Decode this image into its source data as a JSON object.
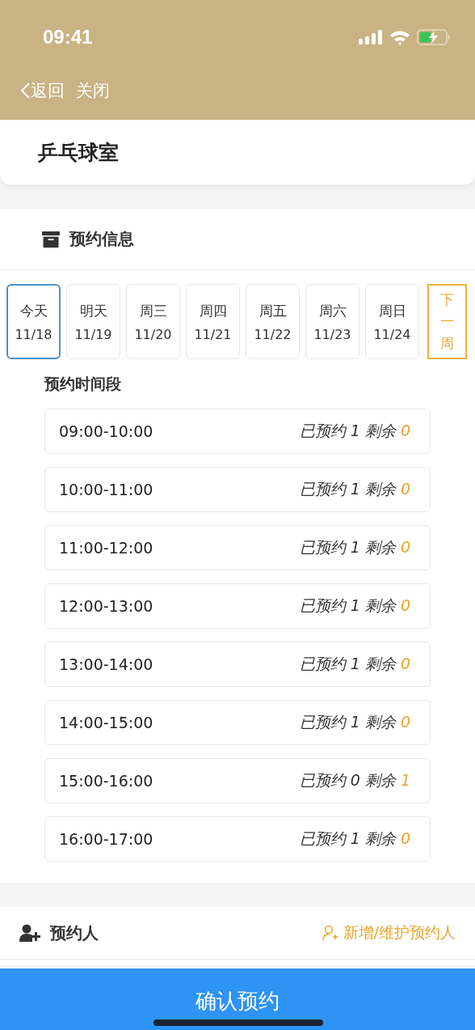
{
  "status_bar": {
    "time": "09:41"
  },
  "nav": {
    "back": "返回",
    "close": "关闭"
  },
  "venue": {
    "title": "乒乓球室"
  },
  "booking": {
    "title": "预约信息",
    "days": [
      {
        "label": "今天",
        "date": "11/18",
        "selected": true
      },
      {
        "label": "明天",
        "date": "11/19",
        "selected": false
      },
      {
        "label": "周三",
        "date": "11/20",
        "selected": false
      },
      {
        "label": "周四",
        "date": "11/21",
        "selected": false
      },
      {
        "label": "周五",
        "date": "11/22",
        "selected": false
      },
      {
        "label": "周六",
        "date": "11/23",
        "selected": false
      },
      {
        "label": "周日",
        "date": "11/24",
        "selected": false
      }
    ],
    "next_week": "下一周",
    "slots_title": "预约时间段",
    "slots": [
      {
        "time": "09:00-10:00",
        "booked_label": "已预约",
        "booked": "1",
        "remaining_label": "剩余",
        "remaining": "0"
      },
      {
        "time": "10:00-11:00",
        "booked_label": "已预约",
        "booked": "1",
        "remaining_label": "剩余",
        "remaining": "0"
      },
      {
        "time": "11:00-12:00",
        "booked_label": "已预约",
        "booked": "1",
        "remaining_label": "剩余",
        "remaining": "0"
      },
      {
        "time": "12:00-13:00",
        "booked_label": "已预约",
        "booked": "1",
        "remaining_label": "剩余",
        "remaining": "0"
      },
      {
        "time": "13:00-14:00",
        "booked_label": "已预约",
        "booked": "1",
        "remaining_label": "剩余",
        "remaining": "0"
      },
      {
        "time": "14:00-15:00",
        "booked_label": "已预约",
        "booked": "1",
        "remaining_label": "剩余",
        "remaining": "0"
      },
      {
        "time": "15:00-16:00",
        "booked_label": "已预约",
        "booked": "0",
        "remaining_label": "剩余",
        "remaining": "1"
      },
      {
        "time": "16:00-17:00",
        "booked_label": "已预约",
        "booked": "1",
        "remaining_label": "剩余",
        "remaining": "0"
      }
    ]
  },
  "booker": {
    "title": "预约人",
    "action": "新增/维护预约人"
  },
  "confirm_button": "确认预约"
}
